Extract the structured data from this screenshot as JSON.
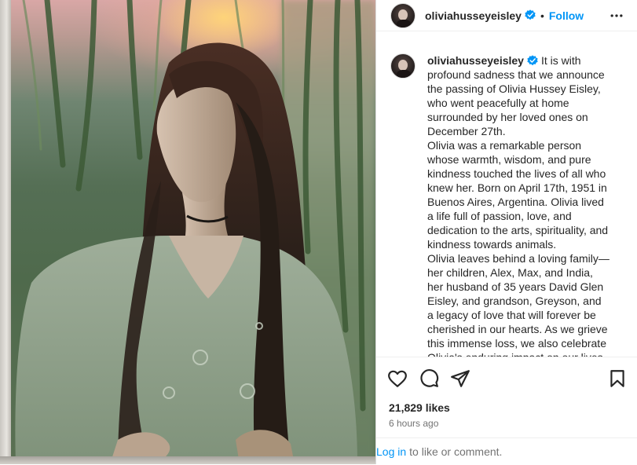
{
  "post": {
    "username": "oliviahusseyeisley",
    "verified": true,
    "follow_label": "Follow",
    "dot": "•",
    "caption_paragraphs": [
      "It is with profound sadness that we announce the passing of Olivia Hussey Eisley, who went peacefully at home surrounded by her loved ones on December 27th.",
      "Olivia was a remarkable person whose warmth, wisdom, and pure kindness touched the lives of all who knew her. Born on April 17th, 1951 in Buenos Aires, Argentina. Olivia lived a life full of passion, love, and dedication to the arts, spirituality, and kindness towards animals.",
      "Olivia leaves behind a loving family—her children, Alex, Max, and India, her husband of 35 years David Glen Eisley, and grandson, Greyson, and a legacy of love that will forever be cherished in our hearts. As we grieve this immense loss, we also celebrate Olivia's enduring impact on our lives."
    ],
    "likes": "21,829 likes",
    "time_ago": "6 hours ago",
    "login_link": "Log in",
    "login_rest": "to like or comment."
  },
  "icons": {
    "like": "heart-outline-icon",
    "comment": "comment-bubble-icon",
    "share": "paper-plane-icon",
    "save": "bookmark-outline-icon",
    "more": "more-horizontal-icon",
    "verified": "verified-badge-icon"
  },
  "colors": {
    "accent": "#0095f6",
    "text": "#262626",
    "muted": "#737373",
    "border": "#dbdbdb"
  }
}
